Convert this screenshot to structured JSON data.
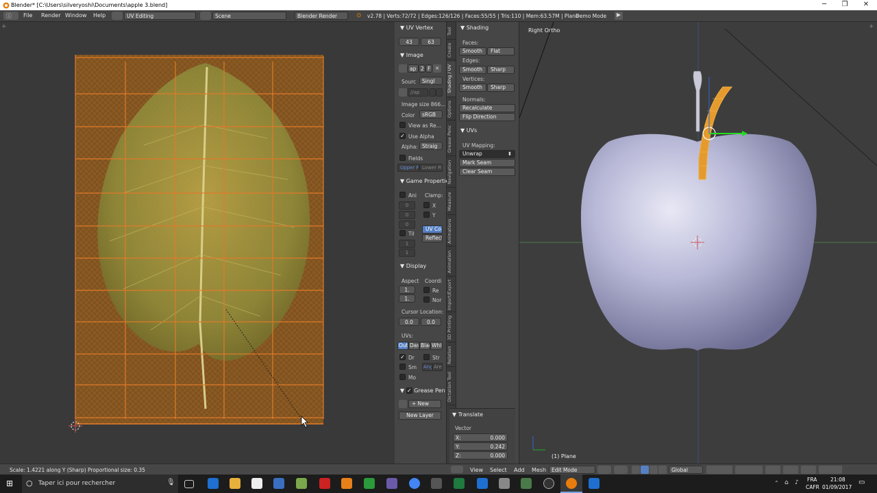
{
  "window": {
    "title": "Blender* [C:\\Users\\silveryoshi\\Documents\\apple 3.blend]",
    "minimize": "─",
    "restore": "❐",
    "close": "✕"
  },
  "menubar": {
    "menus": [
      "File",
      "Render",
      "Window",
      "Help"
    ],
    "screen_layout": "UV Editing",
    "scene": "Scene",
    "render_engine": "Blender Render",
    "stats": "v2.78 | Verts:72/72 | Edges:126/126 | Faces:55/55 | Tris:110 | Mem:63.57M | Plane",
    "demo_mode": "Demo Mode"
  },
  "uv_panel": {
    "uv_vertex_header": "UV Vertex",
    "uv_x": "43",
    "uv_y": "63",
    "image_header": "Image",
    "image_name": "ap",
    "image_users": "2",
    "image_f": "F",
    "source_label": "Sourc",
    "source_value": "Singl",
    "filepath": "//ap",
    "image_size": "Image size 866...",
    "color_label": "Color",
    "color_value": "sRGB",
    "view_as_render": "View as Re...",
    "use_alpha": "Use Alpha",
    "alpha_label": "Alpha:",
    "alpha_value": "Straig",
    "fields": "Fields",
    "upper_first": "Upper F",
    "lower_first": "Lower Fi",
    "game_header": "Game Propertie",
    "ani": "Ani",
    "clamp": "Clamp:",
    "clamp_x": "X",
    "clamp_y": "Y",
    "ani_val1": "0",
    "ani_val2": "0",
    "ani_val3": "0",
    "uv_co": "UV Co",
    "reflect": "Reflect",
    "til": "Til",
    "til_val1": "1",
    "til_val2": "1",
    "display_header": "Display",
    "aspect": "Aspect",
    "coord": "Coordi",
    "aspect_x": "1.",
    "aspect_y": "1.",
    "re": "Re",
    "nor": "Nor",
    "cursor_location": "Cursor Location:",
    "cursor_x": "0.0",
    "cursor_y": "0.0",
    "uvs": "UVs:",
    "uv_modes": [
      "Out",
      "Das",
      "Blac",
      "Whit"
    ],
    "dr": "Dr",
    "str": "Str",
    "sm": "Sm",
    "ang": "Ang",
    "are": "Are",
    "mo": "Mo",
    "grease_header": "Grease Pen",
    "new": "New",
    "new_layer": "New Layer"
  },
  "tabs": [
    "Tool",
    "Create",
    "Shading / UV",
    "Options",
    "Grease Penc",
    "Navigation",
    "Measure",
    "Animations",
    "Animation",
    "Import/Export",
    "3D Printing",
    "Relation",
    "Dictation Tool"
  ],
  "tool_panel": {
    "shading_header": "Shading",
    "faces_label": "Faces:",
    "smooth": "Smooth",
    "flat": "Flat",
    "edges_label": "Edges:",
    "sharp": "Sharp",
    "vertices_label": "Vertices:",
    "normals_label": "Normals:",
    "recalculate": "Recalculate",
    "flip_direction": "Flip Direction",
    "uvs_header": "UVs",
    "uv_mapping_label": "UV Mapping:",
    "unwrap": "Unwrap",
    "mark_seam": "Mark Seam",
    "clear_seam": "Clear Seam",
    "translate_header": "Translate",
    "vector_label": "Vector",
    "vec_x_label": "X:",
    "vec_x": "0.000",
    "vec_y_label": "Y:",
    "vec_y": "0.242",
    "vec_z_label": "Z:",
    "vec_z": "0.000"
  },
  "viewport": {
    "view_name": "Right Ortho",
    "object_label": "(1) Plane"
  },
  "bottom_header": {
    "menus": [
      "View",
      "Select",
      "Add",
      "Mesh"
    ],
    "mode": "Edit Mode",
    "orientation": "Global"
  },
  "status": {
    "text": "Scale: 1.4221 along Y (Sharp) Proportional size: 0.35"
  },
  "taskbar": {
    "search_placeholder": "Taper ici pour rechercher",
    "lang_line1": "FRA",
    "lang_line2": "CAFR",
    "time": "21:08",
    "date": "01/09/2017"
  },
  "colors": {
    "uv_mesh": "#e07a2a",
    "selected_orange": "#f0a030",
    "apple": "#b9b9d8",
    "active_blue": "#5680c2"
  }
}
